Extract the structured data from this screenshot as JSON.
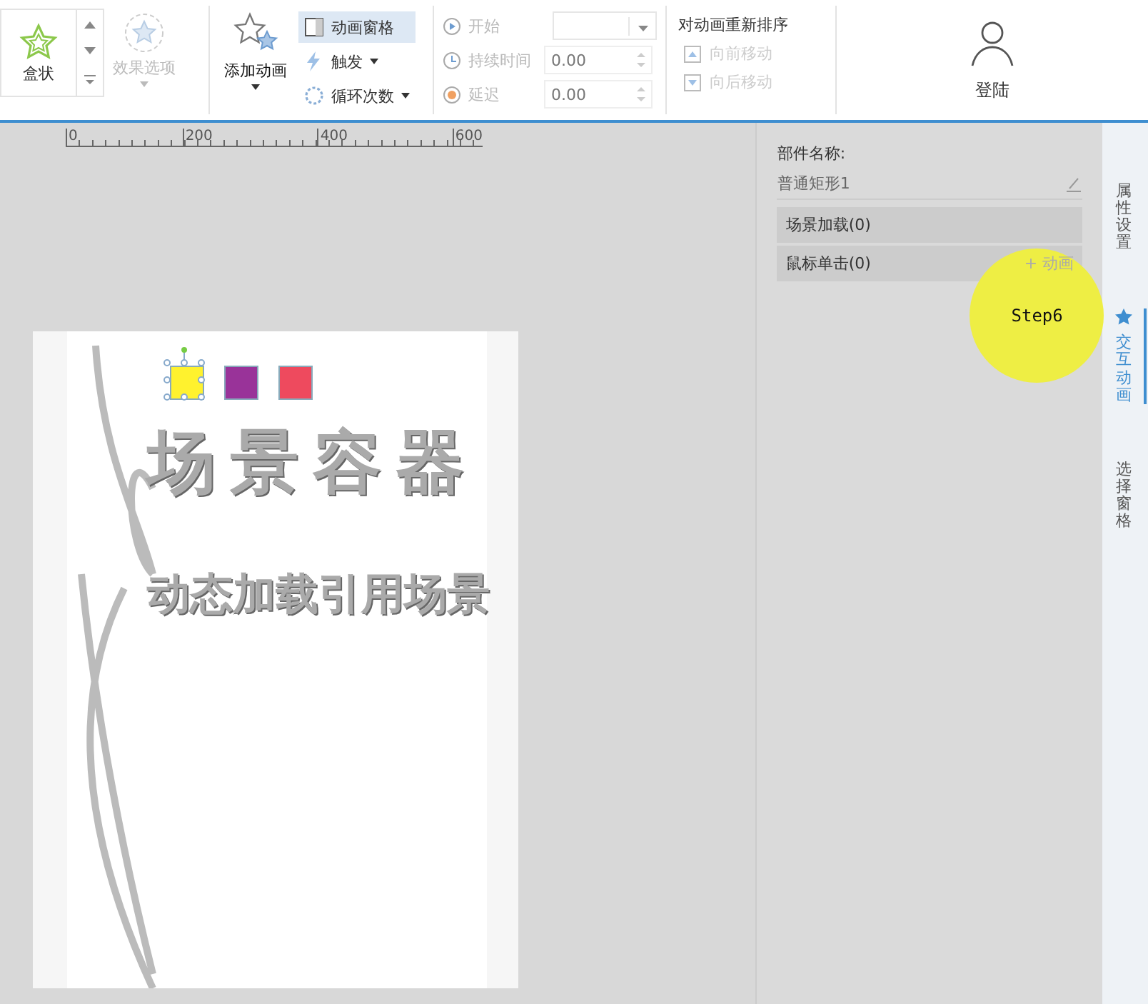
{
  "toolbar": {
    "effect": {
      "label": "盒状"
    },
    "effect_options": {
      "label": "效果选项",
      "disabled": true
    },
    "add_animation": {
      "label": "添加动画"
    },
    "small_buttons": [
      {
        "kind": "pane",
        "label": "动画窗格",
        "selected": true
      },
      {
        "kind": "trigger",
        "label": "触发",
        "selected": false
      },
      {
        "kind": "loop",
        "label": "循环次数",
        "selected": false
      }
    ],
    "timing": [
      {
        "kind": "start",
        "label": "开始"
      },
      {
        "kind": "duration",
        "label": "持续时间",
        "value": "0.00"
      },
      {
        "kind": "delay",
        "label": "延迟",
        "value": "0.00"
      }
    ],
    "reorder": {
      "title": "对动画重新排序",
      "buttons": [
        {
          "kind": "up",
          "label": "向前移动",
          "disabled": true
        },
        {
          "kind": "down",
          "label": "向后移动",
          "disabled": true
        }
      ]
    },
    "login": {
      "label": "登陆"
    }
  },
  "ruler": {
    "ticks": [
      "0",
      "200",
      "400",
      "600"
    ]
  },
  "canvas": {
    "shapes": [
      {
        "color": "#fff22e",
        "selected": true
      },
      {
        "color": "#993399",
        "selected": false
      },
      {
        "color": "#ee4a5e",
        "selected": false
      }
    ],
    "artwork_title": "场景容器",
    "artwork_subtitle": "动态加载引用场景"
  },
  "panel": {
    "name_label": "部件名称:",
    "name_value": "普通矩形1",
    "events": [
      {
        "label": "场景加载(0)"
      },
      {
        "label": "鼠标单击(0)",
        "action": "+ 动画"
      }
    ]
  },
  "side_tabs": [
    {
      "kind": "props",
      "label": "属性设置",
      "selected": false
    },
    {
      "kind": "anim",
      "label": "交互动画",
      "selected": true
    },
    {
      "kind": "pane",
      "label": "选择窗格",
      "selected": false
    }
  ],
  "annotation": {
    "label": "Step6"
  }
}
